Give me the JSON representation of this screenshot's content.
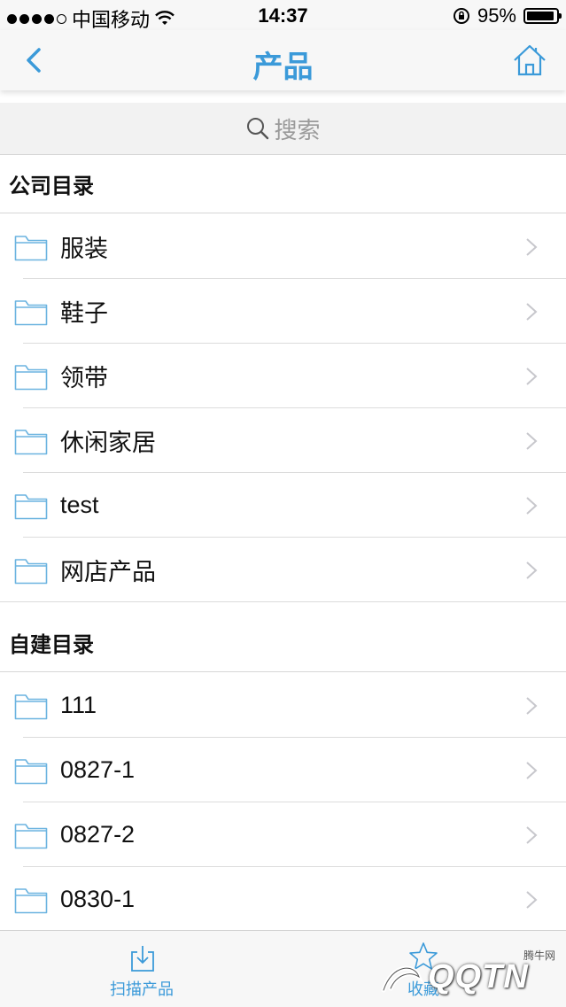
{
  "status_bar": {
    "carrier": "中国移动",
    "time": "14:37",
    "battery_percent": "95%",
    "battery_level": 0.95
  },
  "nav": {
    "title": "产品",
    "back_icon": "chevron-left-icon",
    "home_icon": "home-icon"
  },
  "search": {
    "placeholder": "搜索"
  },
  "sections": [
    {
      "title": "公司目录",
      "items": [
        "服装",
        "鞋子",
        "领带",
        "休闲家居",
        "test",
        "网店产品"
      ]
    },
    {
      "title": "自建目录",
      "items": [
        "111",
        "0827-1",
        "0827-2",
        "0830-1"
      ]
    }
  ],
  "tab_bar": {
    "scan_label": "扫描产品",
    "fav_label": "收藏"
  },
  "watermark": {
    "text": "QQTN",
    "small": "腾牛网"
  },
  "colors": {
    "accent": "#3b9ad9",
    "folder": "#6cb4e0"
  }
}
